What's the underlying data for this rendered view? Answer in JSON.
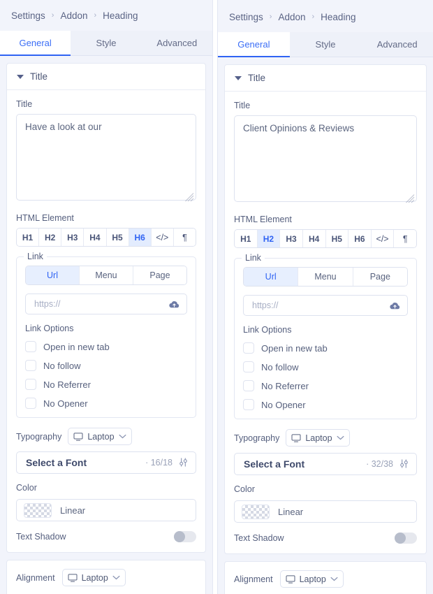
{
  "breadcrumb": {
    "items": [
      "Settings",
      "Addon",
      "Heading"
    ],
    "separator": "›"
  },
  "tabs": [
    {
      "label": "General",
      "active": true
    },
    {
      "label": "Style",
      "active": false
    },
    {
      "label": "Advanced",
      "active": false
    }
  ],
  "panels": [
    {
      "id": "left",
      "section": {
        "title": "Title"
      },
      "title_field": {
        "label": "Title",
        "value": "Have a look at our"
      },
      "html_element": {
        "label": "HTML Element",
        "options": [
          "H1",
          "H2",
          "H3",
          "H4",
          "H5",
          "H6",
          "</>",
          "¶"
        ],
        "selected": "H6"
      },
      "link": {
        "legend": "Link",
        "source_tabs": [
          "Url",
          "Menu",
          "Page"
        ],
        "source_selected": "Url",
        "url_placeholder": "https://",
        "url_value": "",
        "options_label": "Link Options",
        "options": [
          {
            "label": "Open in new tab",
            "checked": false
          },
          {
            "label": "No follow",
            "checked": false
          },
          {
            "label": "No Referrer",
            "checked": false
          },
          {
            "label": "No Opener",
            "checked": false
          }
        ]
      },
      "typography": {
        "label": "Typography",
        "device": "Laptop",
        "font_name": "Select a Font",
        "font_size": "· 16/18"
      },
      "color": {
        "label": "Color",
        "value": "Linear"
      },
      "text_shadow": {
        "label": "Text Shadow",
        "enabled": false
      },
      "alignment": {
        "label": "Alignment",
        "device": "Laptop"
      }
    },
    {
      "id": "right",
      "section": {
        "title": "Title"
      },
      "title_field": {
        "label": "Title",
        "value": "Client Opinions & Reviews"
      },
      "html_element": {
        "label": "HTML Element",
        "options": [
          "H1",
          "H2",
          "H3",
          "H4",
          "H5",
          "H6",
          "</>",
          "¶"
        ],
        "selected": "H2"
      },
      "link": {
        "legend": "Link",
        "source_tabs": [
          "Url",
          "Menu",
          "Page"
        ],
        "source_selected": "Url",
        "url_placeholder": "https://",
        "url_value": "",
        "options_label": "Link Options",
        "options": [
          {
            "label": "Open in new tab",
            "checked": false
          },
          {
            "label": "No follow",
            "checked": false
          },
          {
            "label": "No Referrer",
            "checked": false
          },
          {
            "label": "No Opener",
            "checked": false
          }
        ]
      },
      "typography": {
        "label": "Typography",
        "device": "Laptop",
        "font_name": "Select a Font",
        "font_size": "· 32/38"
      },
      "color": {
        "label": "Color",
        "value": "Linear"
      },
      "text_shadow": {
        "label": "Text Shadow",
        "enabled": false
      },
      "alignment": {
        "label": "Alignment",
        "device": "Laptop"
      }
    }
  ],
  "colors": {
    "accent": "#2f63f3",
    "accent_soft": "#e3ecfe",
    "panel_bg": "#f2f4fb",
    "card_bg": "#ffffff",
    "border": "#dde2ef",
    "text": "#555f7e",
    "muted": "#a7aec4"
  }
}
